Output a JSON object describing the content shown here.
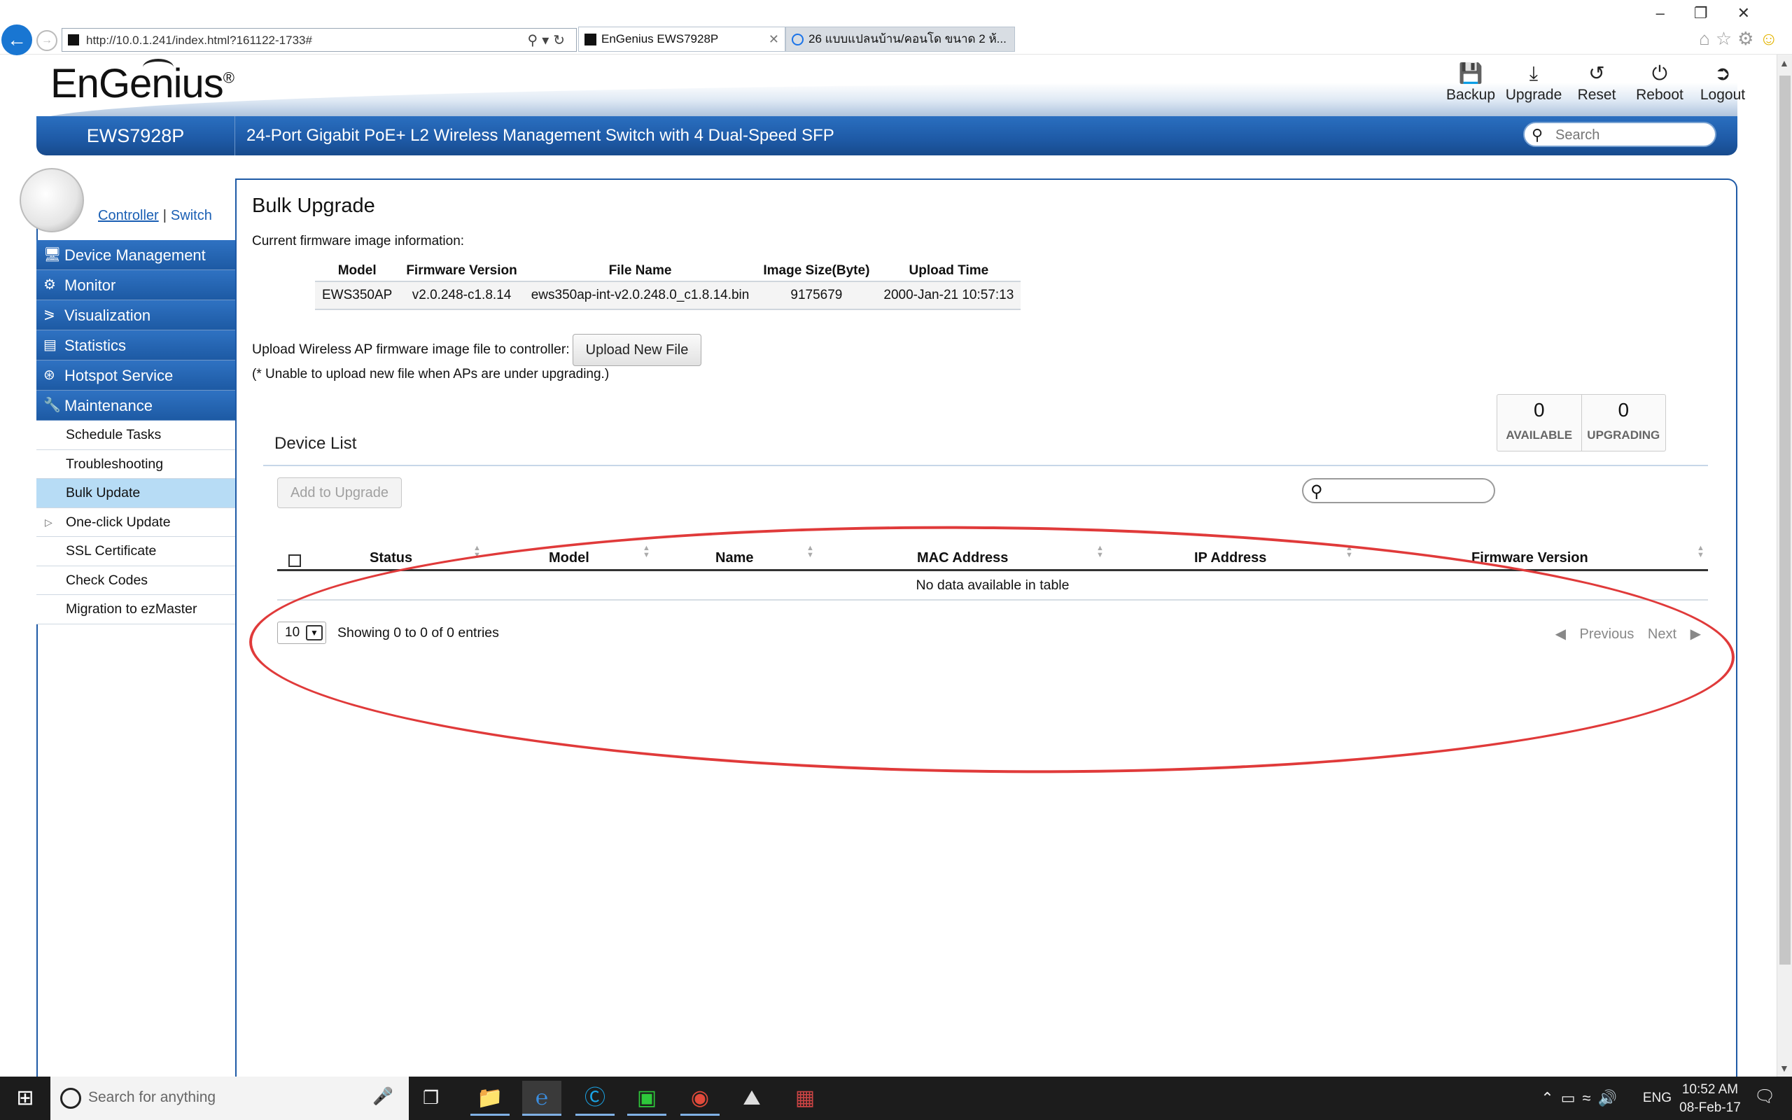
{
  "browser": {
    "address": "http://10.0.1.241/index.html?161122-1733#",
    "tabs": [
      {
        "label": "EnGenius EWS7928P"
      },
      {
        "label": "26 แบบแปลนบ้าน/คอนโด ขนาด 2 ห้..."
      }
    ]
  },
  "header": {
    "brand": "EnGenius",
    "actions": [
      {
        "label": "Backup",
        "icon": "save-icon"
      },
      {
        "label": "Upgrade",
        "icon": "download-icon"
      },
      {
        "label": "Reset",
        "icon": "reset-icon"
      },
      {
        "label": "Reboot",
        "icon": "power-icon"
      },
      {
        "label": "Logout",
        "icon": "logout-icon"
      }
    ],
    "model": "EWS7928P",
    "description": "24-Port Gigabit PoE+ L2 Wireless Management Switch with 4 Dual-Speed SFP",
    "search_placeholder": "Search"
  },
  "sidebar": {
    "mode_links": {
      "controller": "Controller",
      "switch": "Switch"
    },
    "sections": [
      {
        "label": "Device Management",
        "icon": "devices-icon"
      },
      {
        "label": "Monitor",
        "icon": "monitor-icon"
      },
      {
        "label": "Visualization",
        "icon": "share-icon"
      },
      {
        "label": "Statistics",
        "icon": "chart-icon"
      },
      {
        "label": "Hotspot Service",
        "icon": "wireless-icon"
      },
      {
        "label": "Maintenance",
        "icon": "wrench-icon"
      }
    ],
    "sub_items": [
      {
        "label": "Schedule Tasks"
      },
      {
        "label": "Troubleshooting"
      },
      {
        "label": "Bulk Update",
        "active": true
      },
      {
        "label": "One-click Update",
        "expandable": true
      },
      {
        "label": "SSL Certificate"
      },
      {
        "label": "Check Codes"
      },
      {
        "label": "Migration to ezMaster"
      }
    ]
  },
  "main": {
    "title": "Bulk Upgrade",
    "firmware_info_label": "Current firmware image information:",
    "firmware_table": {
      "columns": [
        "Model",
        "Firmware Version",
        "File Name",
        "Image Size(Byte)",
        "Upload Time"
      ],
      "rows": [
        [
          "EWS350AP",
          "v2.0.248-c1.8.14",
          "ews350ap-int-v2.0.248.0_c1.8.14.bin",
          "9175679",
          "2000-Jan-21 10:57:13"
        ]
      ]
    },
    "upload_label": "Upload Wireless AP firmware image file to controller:",
    "upload_button": "Upload New File",
    "upload_note": "(* Unable to upload new file when APs are under upgrading.)",
    "counters": [
      {
        "value": "0",
        "label": "AVAILABLE"
      },
      {
        "value": "0",
        "label": "UPGRADING"
      }
    ],
    "device_list_title": "Device List",
    "add_button": "Add to Upgrade",
    "device_table": {
      "columns": [
        "Status",
        "Model",
        "Name",
        "MAC Address",
        "IP Address",
        "Firmware Version"
      ],
      "empty_text": "No data available in table"
    },
    "page_size": "10",
    "entries_text": "Showing 0 to 0 of 0 entries",
    "pager": {
      "previous": "Previous",
      "next": "Next"
    },
    "annotation_color": "#e03a3a"
  },
  "taskbar": {
    "search_placeholder": "Search for anything",
    "language": "ENG",
    "time": "10:52 AM",
    "date": "08-Feb-17"
  },
  "colors": {
    "brand_blue": "#1f5aa6",
    "active_item": "#b7dcf5"
  }
}
